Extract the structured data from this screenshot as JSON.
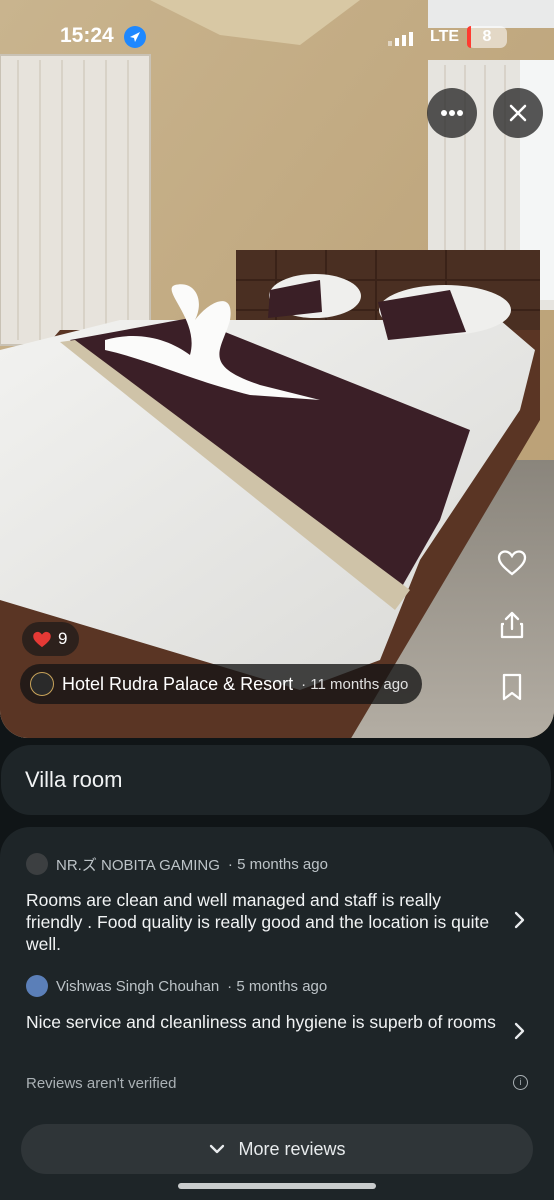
{
  "status_bar": {
    "time": "15:24",
    "network": "LTE",
    "battery": "8"
  },
  "photo": {
    "likes_count": "9",
    "place_name": "Hotel Rudra Palace & Resort",
    "posted_ago": "· 11 months ago"
  },
  "caption": {
    "text": "Villa room"
  },
  "reviews": [
    {
      "author": "NR.ズ NOBITA GAMING",
      "ago": "· 5 months ago",
      "text": "Rooms are clean and well managed and staff is really friendly . Food quality is really good and the location is quite well."
    },
    {
      "author": "Vishwas Singh Chouhan",
      "ago": "· 5 months ago",
      "text": "Nice service and cleanliness and hygiene is superb of rooms"
    }
  ],
  "not_verified_note": "Reviews aren't verified",
  "more_reviews_label": "More reviews",
  "colors": {
    "battery_low": "#ff3b30",
    "location_badge": "#1e88ff",
    "heart": "#e53935"
  }
}
